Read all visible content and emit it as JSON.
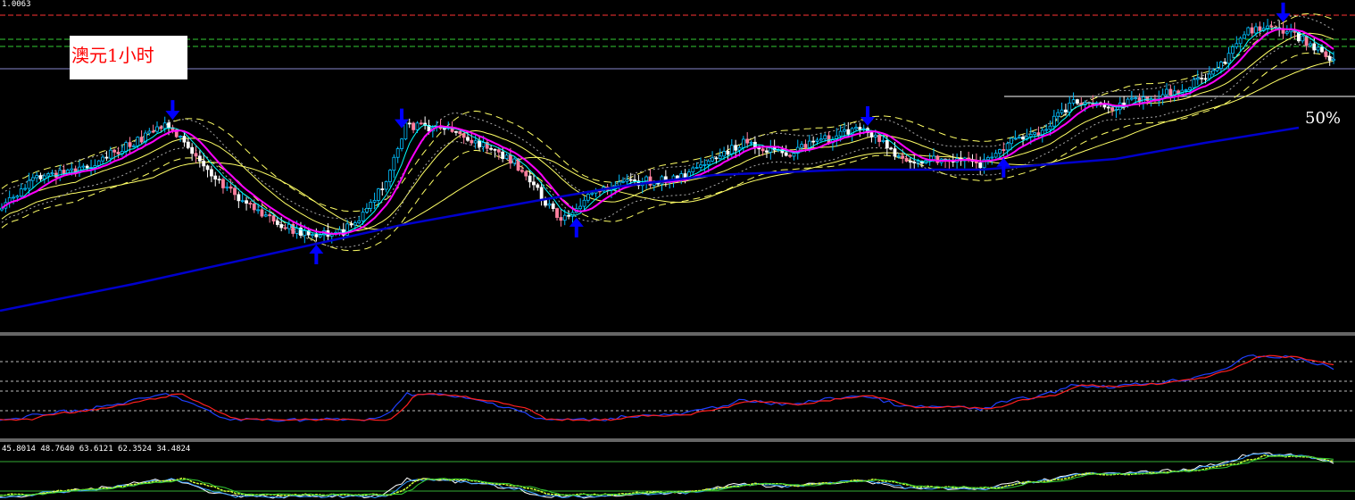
{
  "price_label": "1.0063",
  "title_label": "澳元1小时",
  "fib_label": "50%",
  "indicator_values": "45.8014 48.7640 63.6121 62.3524 34.4824",
  "colors": {
    "background": "#000000",
    "bull_candle": "#00bfff",
    "bear_candle": "#ffffff",
    "bear_candle_alt": "#ff7f9f",
    "ma_fast": "#ff00ff",
    "ma_slow": "#0000cc",
    "ma_yellow": "#ffff66",
    "ma_cyan": "#00ffff",
    "band_grey": "#aaaaaa",
    "arrow": "#0000ff",
    "stoch_main": "#ff2020",
    "stoch_signal": "#2040ff",
    "osc_white": "#ffffff",
    "osc_yellow": "#ccff33",
    "osc_green": "#33cc33",
    "osc_blue": "#3399ff",
    "ref_red": "#ff3333",
    "ref_green": "#33cc33"
  },
  "chart_data": {
    "type": "candlestick",
    "title": "澳元1小时",
    "price_ref_label": "1.0063",
    "fib_level_label": "50%",
    "reversal_arrows": [
      {
        "direction": "down",
        "bar": 44
      },
      {
        "direction": "up",
        "bar": 81
      },
      {
        "direction": "down",
        "bar": 103
      },
      {
        "direction": "up",
        "bar": 148
      },
      {
        "direction": "down",
        "bar": 223
      },
      {
        "direction": "up",
        "bar": 258
      },
      {
        "direction": "down",
        "bar": 330
      }
    ],
    "sub_indicators": [
      {
        "name": "",
        "type": "oscillator",
        "lines": 2
      },
      {
        "name": "",
        "type": "oscillator",
        "lines": 4,
        "values_label": "45.8014 48.7640 63.6121 62.3524 34.4824"
      }
    ]
  }
}
